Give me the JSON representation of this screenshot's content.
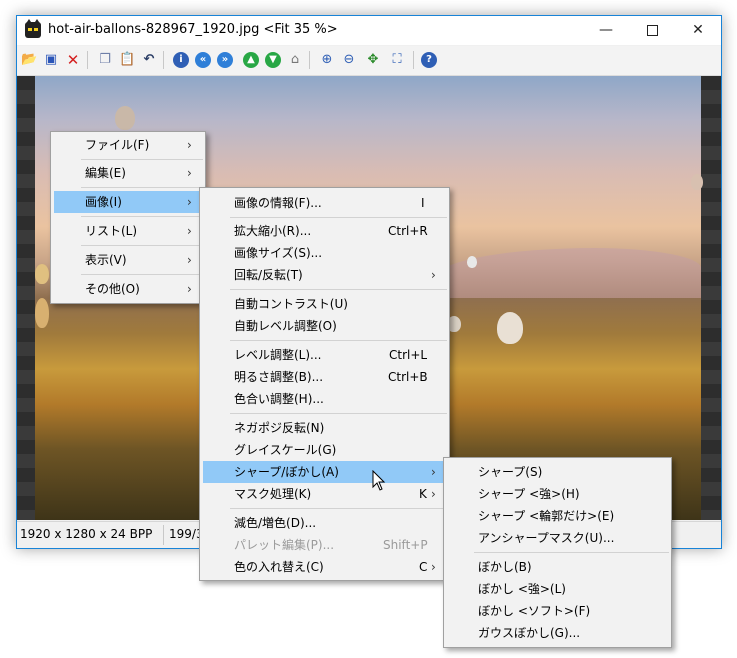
{
  "window": {
    "title": "hot-air-ballons-828967_1920.jpg <Fit 35 %>",
    "minimize": "—",
    "close": "✕"
  },
  "toolbar": {
    "icons": [
      "open-icon",
      "save-icon",
      "delete-icon",
      "copy-icon",
      "paste-icon",
      "undo-icon",
      "info-icon",
      "first-image-icon",
      "previous-image-icon",
      "next-image-icon",
      "last-image-icon",
      "slideshow-icon",
      "zoom-in-icon",
      "zoom-out-icon",
      "fit-window-icon",
      "fit-screen-icon",
      "help-icon"
    ]
  },
  "statusbar": {
    "dimensions": "1920 x 1280 x 24 BPP",
    "position": "199/3"
  },
  "main_menu": {
    "items": [
      {
        "label": "ファイル(F)",
        "has_submenu": true
      },
      {
        "label": "編集(E)",
        "has_submenu": true
      },
      {
        "label": "画像(I)",
        "has_submenu": true,
        "active": true
      },
      {
        "label": "リスト(L)",
        "has_submenu": true
      },
      {
        "label": "表示(V)",
        "has_submenu": true
      },
      {
        "label": "その他(O)",
        "has_submenu": true
      }
    ]
  },
  "image_menu": {
    "items": [
      {
        "label": "画像の情報(F)...",
        "shortcut": "I"
      },
      {
        "label": "拡大縮小(R)...",
        "shortcut": "Ctrl+R"
      },
      {
        "label": "画像サイズ(S)...",
        "shortcut": ""
      },
      {
        "label": "回転/反転(T)",
        "shortcut": "",
        "has_submenu": true
      },
      {
        "label": "自動コントラスト(U)",
        "shortcut": ""
      },
      {
        "label": "自動レベル調整(O)",
        "shortcut": ""
      },
      {
        "label": "レベル調整(L)...",
        "shortcut": "Ctrl+L"
      },
      {
        "label": "明るさ調整(B)...",
        "shortcut": "Ctrl+B"
      },
      {
        "label": "色合い調整(H)...",
        "shortcut": ""
      },
      {
        "label": "ネガポジ反転(N)",
        "shortcut": ""
      },
      {
        "label": "グレイスケール(G)",
        "shortcut": ""
      },
      {
        "label": "シャープ/ぼかし(A)",
        "shortcut": "",
        "has_submenu": true,
        "active": true
      },
      {
        "label": "マスク処理(K)",
        "shortcut": "K",
        "has_submenu": true
      },
      {
        "label": "減色/増色(D)...",
        "shortcut": ""
      },
      {
        "label": "パレット編集(P)...",
        "shortcut": "Shift+P",
        "disabled": true
      },
      {
        "label": "色の入れ替え(C)",
        "shortcut": "C",
        "has_submenu": true
      }
    ]
  },
  "sharpen_menu": {
    "items": [
      {
        "label": "シャープ(S)"
      },
      {
        "label": "シャープ <強>(H)"
      },
      {
        "label": "シャープ <輪郭だけ>(E)"
      },
      {
        "label": "アンシャープマスク(U)..."
      },
      {
        "label": "ぼかし(B)"
      },
      {
        "label": "ぼかし <強>(L)"
      },
      {
        "label": "ぼかし <ソフト>(F)"
      },
      {
        "label": "ガウスぼかし(G)..."
      }
    ]
  },
  "submenu_arrow": "›",
  "colors": {
    "accent_border": "#1883d7",
    "menu_highlight": "#91c9f7",
    "menu_bg": "#f2f2f2"
  }
}
